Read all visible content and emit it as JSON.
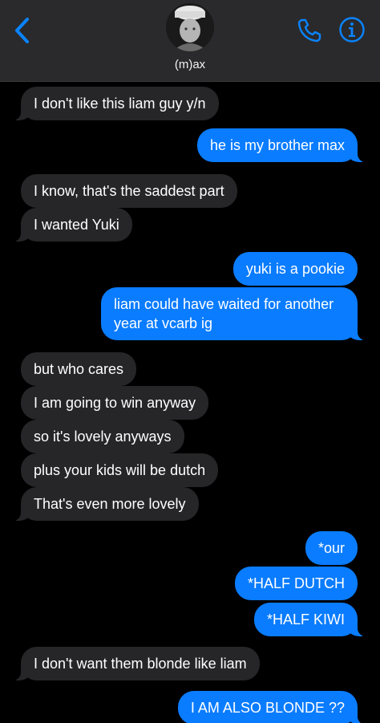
{
  "header": {
    "back_icon": "chevron-left-icon",
    "contact_name": "(m)ax",
    "call_icon": "phone-icon",
    "info_icon": "info-icon",
    "accent_color": "#0a84ff"
  },
  "messages": [
    {
      "direction": "incoming",
      "text": "I don't like this liam guy y/n"
    },
    {
      "direction": "outgoing",
      "text": "he is my brother max"
    },
    {
      "direction": "incoming",
      "text": "I know, that's the saddest part"
    },
    {
      "direction": "incoming",
      "text": "I wanted Yuki"
    },
    {
      "direction": "outgoing",
      "text": "yuki is a pookie"
    },
    {
      "direction": "outgoing",
      "text": "liam could have waited for another year at vcarb ig"
    },
    {
      "direction": "incoming",
      "text": "but who cares"
    },
    {
      "direction": "incoming",
      "text": "I am going to win anyway"
    },
    {
      "direction": "incoming",
      "text": "so it's lovely anyways"
    },
    {
      "direction": "incoming",
      "text": "plus your kids will be dutch"
    },
    {
      "direction": "incoming",
      "text": "That's even more lovely"
    },
    {
      "direction": "outgoing",
      "text": "*our"
    },
    {
      "direction": "outgoing",
      "text": "*HALF DUTCH"
    },
    {
      "direction": "outgoing",
      "text": "*HALF KIWI"
    },
    {
      "direction": "incoming",
      "text": "I don't want them blonde like liam"
    },
    {
      "direction": "outgoing",
      "text": "I AM ALSO BLONDE ??"
    }
  ],
  "colors": {
    "incoming_bubble": "#262628",
    "outgoing_bubble": "#0a7cff",
    "background": "#000000"
  }
}
